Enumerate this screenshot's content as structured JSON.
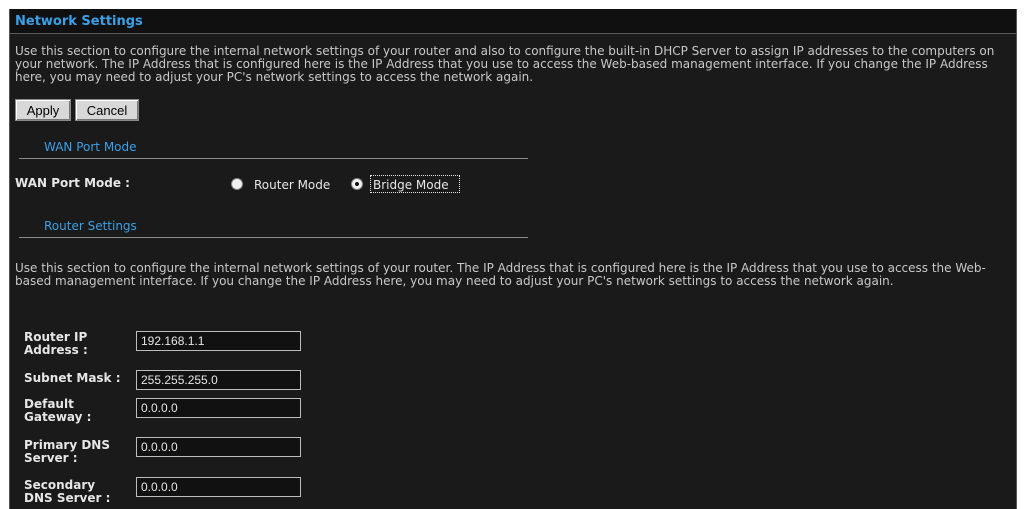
{
  "title": "Network Settings",
  "description_1": "Use this section to configure the internal network settings of your router and also to configure the built-in DHCP Server to assign IP addresses to the computers on your network. The IP Address that is configured here is the IP Address that you use to access the Web-based management interface. If you change the IP Address here, you may need to adjust your PC's network settings to access the network again.",
  "buttons": {
    "apply": "Apply",
    "cancel": "Cancel"
  },
  "wan_section": {
    "heading": "WAN Port Mode",
    "label": "WAN Port Mode :",
    "options": [
      {
        "label": "Router Mode",
        "selected": false
      },
      {
        "label": "Bridge Mode",
        "selected": true
      }
    ]
  },
  "router_section": {
    "heading": "Router Settings",
    "description": "Use this section to configure the internal network settings of your router. The IP Address that is configured here is the IP Address that you use to access the Web-based management interface. If you change the IP Address here, you may need to adjust your PC's network settings to access the network again.",
    "fields": [
      {
        "label_line1": "Router IP",
        "label_line2": "Address :",
        "value": "192.168.1.1"
      },
      {
        "label_line1": "Subnet Mask :",
        "label_line2": "",
        "value": "255.255.255.0"
      },
      {
        "label_line1": "Default",
        "label_line2": "Gateway :",
        "value": "0.0.0.0"
      },
      {
        "label_line1": "Primary DNS",
        "label_line2": "Server :",
        "value": "0.0.0.0"
      },
      {
        "label_line1": "Secondary",
        "label_line2": "DNS Server :",
        "value": "0.0.0.0"
      }
    ]
  }
}
